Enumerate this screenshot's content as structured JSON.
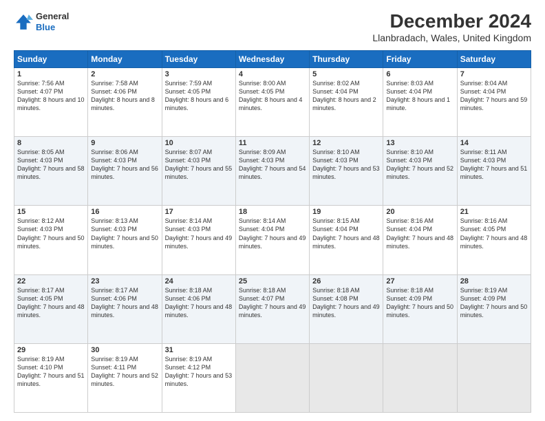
{
  "header": {
    "logo": {
      "general": "General",
      "blue": "Blue"
    },
    "title": "December 2024",
    "location": "Llanbradach, Wales, United Kingdom"
  },
  "calendar": {
    "days": [
      "Sunday",
      "Monday",
      "Tuesday",
      "Wednesday",
      "Thursday",
      "Friday",
      "Saturday"
    ],
    "weeks": [
      [
        null,
        {
          "day": "2",
          "sunrise": "7:58 AM",
          "sunset": "4:06 PM",
          "daylight": "8 hours and 8 minutes."
        },
        {
          "day": "3",
          "sunrise": "7:59 AM",
          "sunset": "4:05 PM",
          "daylight": "8 hours and 6 minutes."
        },
        {
          "day": "4",
          "sunrise": "8:00 AM",
          "sunset": "4:05 PM",
          "daylight": "8 hours and 4 minutes."
        },
        {
          "day": "5",
          "sunrise": "8:02 AM",
          "sunset": "4:04 PM",
          "daylight": "8 hours and 2 minutes."
        },
        {
          "day": "6",
          "sunrise": "8:03 AM",
          "sunset": "4:04 PM",
          "daylight": "8 hours and 1 minute."
        },
        {
          "day": "7",
          "sunrise": "8:04 AM",
          "sunset": "4:04 PM",
          "daylight": "7 hours and 59 minutes."
        }
      ],
      [
        {
          "day": "1",
          "sunrise": "7:56 AM",
          "sunset": "4:07 PM",
          "daylight": "8 hours and 10 minutes."
        },
        null,
        null,
        null,
        null,
        null,
        null
      ],
      [
        {
          "day": "8",
          "sunrise": "8:05 AM",
          "sunset": "4:03 PM",
          "daylight": "7 hours and 58 minutes."
        },
        {
          "day": "9",
          "sunrise": "8:06 AM",
          "sunset": "4:03 PM",
          "daylight": "7 hours and 56 minutes."
        },
        {
          "day": "10",
          "sunrise": "8:07 AM",
          "sunset": "4:03 PM",
          "daylight": "7 hours and 55 minutes."
        },
        {
          "day": "11",
          "sunrise": "8:09 AM",
          "sunset": "4:03 PM",
          "daylight": "7 hours and 54 minutes."
        },
        {
          "day": "12",
          "sunrise": "8:10 AM",
          "sunset": "4:03 PM",
          "daylight": "7 hours and 53 minutes."
        },
        {
          "day": "13",
          "sunrise": "8:10 AM",
          "sunset": "4:03 PM",
          "daylight": "7 hours and 52 minutes."
        },
        {
          "day": "14",
          "sunrise": "8:11 AM",
          "sunset": "4:03 PM",
          "daylight": "7 hours and 51 minutes."
        }
      ],
      [
        {
          "day": "15",
          "sunrise": "8:12 AM",
          "sunset": "4:03 PM",
          "daylight": "7 hours and 50 minutes."
        },
        {
          "day": "16",
          "sunrise": "8:13 AM",
          "sunset": "4:03 PM",
          "daylight": "7 hours and 50 minutes."
        },
        {
          "day": "17",
          "sunrise": "8:14 AM",
          "sunset": "4:03 PM",
          "daylight": "7 hours and 49 minutes."
        },
        {
          "day": "18",
          "sunrise": "8:14 AM",
          "sunset": "4:04 PM",
          "daylight": "7 hours and 49 minutes."
        },
        {
          "day": "19",
          "sunrise": "8:15 AM",
          "sunset": "4:04 PM",
          "daylight": "7 hours and 48 minutes."
        },
        {
          "day": "20",
          "sunrise": "8:16 AM",
          "sunset": "4:04 PM",
          "daylight": "7 hours and 48 minutes."
        },
        {
          "day": "21",
          "sunrise": "8:16 AM",
          "sunset": "4:05 PM",
          "daylight": "7 hours and 48 minutes."
        }
      ],
      [
        {
          "day": "22",
          "sunrise": "8:17 AM",
          "sunset": "4:05 PM",
          "daylight": "7 hours and 48 minutes."
        },
        {
          "day": "23",
          "sunrise": "8:17 AM",
          "sunset": "4:06 PM",
          "daylight": "7 hours and 48 minutes."
        },
        {
          "day": "24",
          "sunrise": "8:18 AM",
          "sunset": "4:06 PM",
          "daylight": "7 hours and 48 minutes."
        },
        {
          "day": "25",
          "sunrise": "8:18 AM",
          "sunset": "4:07 PM",
          "daylight": "7 hours and 49 minutes."
        },
        {
          "day": "26",
          "sunrise": "8:18 AM",
          "sunset": "4:08 PM",
          "daylight": "7 hours and 49 minutes."
        },
        {
          "day": "27",
          "sunrise": "8:18 AM",
          "sunset": "4:09 PM",
          "daylight": "7 hours and 50 minutes."
        },
        {
          "day": "28",
          "sunrise": "8:19 AM",
          "sunset": "4:09 PM",
          "daylight": "7 hours and 50 minutes."
        }
      ],
      [
        {
          "day": "29",
          "sunrise": "8:19 AM",
          "sunset": "4:10 PM",
          "daylight": "7 hours and 51 minutes."
        },
        {
          "day": "30",
          "sunrise": "8:19 AM",
          "sunset": "4:11 PM",
          "daylight": "7 hours and 52 minutes."
        },
        {
          "day": "31",
          "sunrise": "8:19 AM",
          "sunset": "4:12 PM",
          "daylight": "7 hours and 53 minutes."
        },
        null,
        null,
        null,
        null
      ]
    ]
  }
}
